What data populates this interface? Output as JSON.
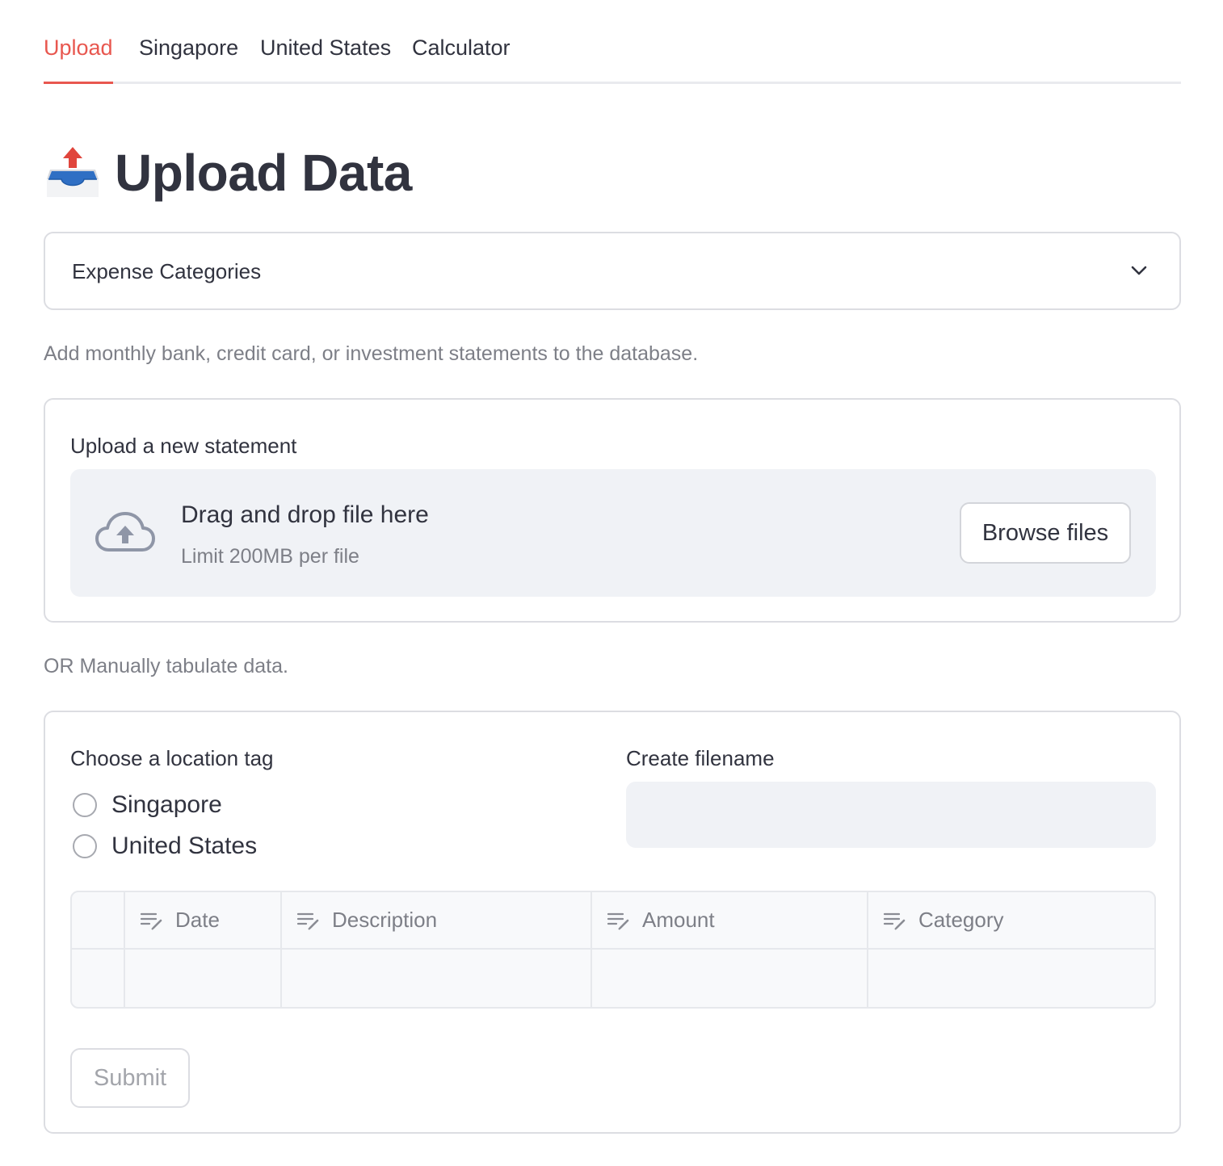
{
  "tabs": [
    {
      "label": "Upload",
      "active": true
    },
    {
      "label": "Singapore",
      "active": false
    },
    {
      "label": "United States",
      "active": false
    },
    {
      "label": "Calculator",
      "active": false
    }
  ],
  "page_title": "Upload Data",
  "title_icon": "outbox-tray-icon",
  "expander": {
    "label": "Expense Categories",
    "icon": "chevron-down-icon"
  },
  "intro_caption": "Add monthly bank, credit card, or investment statements to the database.",
  "uploader": {
    "label": "Upload a new statement",
    "drop_title": "Drag and drop file here",
    "drop_subtitle": "Limit 200MB per file",
    "browse_label": "Browse files",
    "icon": "cloud-upload-icon"
  },
  "manual_caption": "OR Manually tabulate data.",
  "form": {
    "location_label": "Choose a location tag",
    "location_options": [
      "Singapore",
      "United States"
    ],
    "filename_label": "Create filename",
    "filename_value": "",
    "table": {
      "columns": [
        "Date",
        "Description",
        "Amount",
        "Category"
      ],
      "rows": [
        [
          "",
          "",
          "",
          ""
        ]
      ]
    },
    "submit_label": "Submit"
  },
  "colors": {
    "accent": "#e8574f",
    "text": "#31333f",
    "muted": "#7d7f87",
    "input_bg": "#f0f2f6",
    "border": "#dcdde2"
  }
}
